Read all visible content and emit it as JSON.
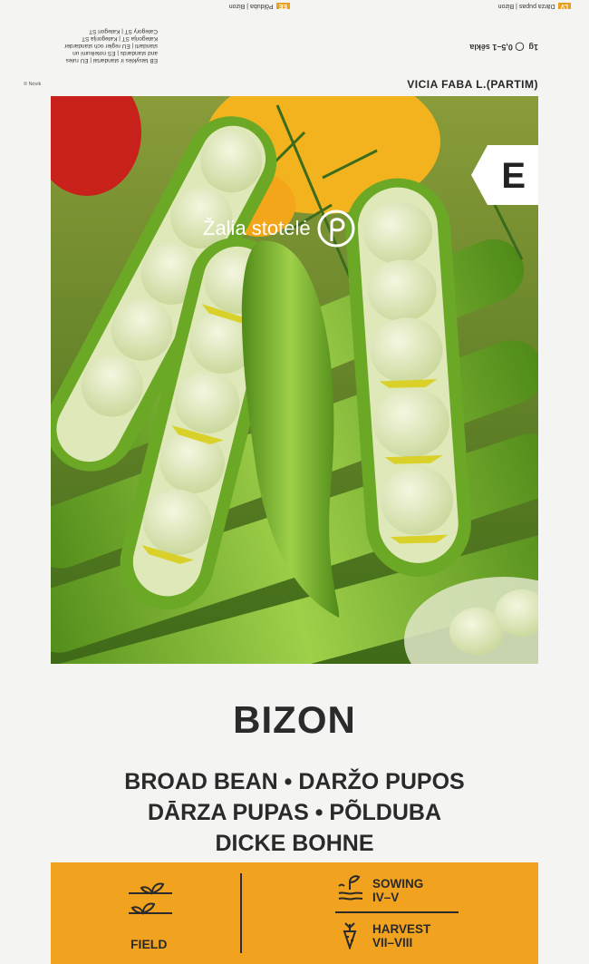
{
  "flap": {
    "weight": "1g",
    "sowing_note": "0,5–1 sēkla",
    "tag_left_code": "LV",
    "tag_left_text": "Dārza pupas | Bizon",
    "tag_right_code": "EE",
    "tag_right_text": "Põlduba | Bizon",
    "legal_lines": [
      "EB taisyklės ir standartai | EU rules",
      "and standards | ES noteikumi un",
      "standarti | EU regler och standarder",
      "Kategorija ST | Kategorija ST",
      "Category ST | Kategori ST"
    ]
  },
  "latin_name": "VICIA FABA L.(PARTIM)",
  "copyright": "© Novik",
  "brand": "Žalia stotelė",
  "category_letter": "E",
  "title": "BIZON",
  "names": [
    "BROAD BEAN • DARŽO PUPOS",
    "DĀRZA PUPAS • PÕLDUBA",
    "DICKE BOHNE"
  ],
  "info": {
    "field_label": "FIELD",
    "sowing_label": "SOWING",
    "sowing_period": "IV–V",
    "harvest_label": "HARVEST",
    "harvest_period": "VII–VIII"
  },
  "colors": {
    "accent_orange": "#f1a21e",
    "text_dark": "#2a2a2a",
    "pod_green": "#7cb52e"
  },
  "icons": [
    "seedling-row-icon",
    "sprout-soil-icon",
    "carrot-icon",
    "logo-circle-icon"
  ]
}
